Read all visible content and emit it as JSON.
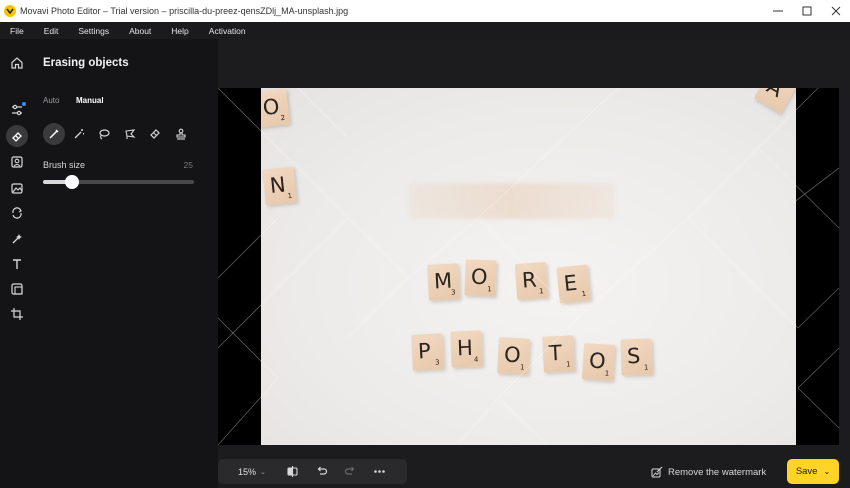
{
  "window": {
    "title": "Movavi Photo Editor – Trial version – priscilla-du-preez-qensZDlj_MA-unsplash.jpg",
    "minimize_icon": "minimize-icon",
    "maximize_icon": "maximize-icon",
    "close_icon": "close-icon"
  },
  "menu": {
    "items": [
      "File",
      "Edit",
      "Settings",
      "About",
      "Help",
      "Activation"
    ]
  },
  "rail": {
    "items": [
      "home-icon",
      "adjust-icon",
      "eraser-icon",
      "portrait-icon",
      "replace-background-icon",
      "transform-icon",
      "retouch-icon",
      "text-icon",
      "frame-icon",
      "crop-icon"
    ]
  },
  "panel": {
    "title": "Erasing objects",
    "tabs": [
      "Auto",
      "Manual"
    ],
    "active_tab": "Manual",
    "tools": [
      "brush-icon",
      "magic-wand-icon",
      "lasso-icon",
      "polygon-lasso-icon",
      "eraser-icon",
      "stamp-icon"
    ],
    "brush_size_label": "Brush size",
    "brush_size_value": "25",
    "brush_size_fraction": 0.19
  },
  "canvas": {
    "tiles": [
      {
        "letter": "O",
        "num": "2"
      },
      {
        "letter": "N",
        "num": "1"
      },
      {
        "letter": "M",
        "num": "3"
      },
      {
        "letter": "O",
        "num": "1"
      },
      {
        "letter": "R",
        "num": "1"
      },
      {
        "letter": "E",
        "num": "1"
      },
      {
        "letter": "P",
        "num": "3"
      },
      {
        "letter": "H",
        "num": "4"
      },
      {
        "letter": "O",
        "num": "1"
      },
      {
        "letter": "T",
        "num": "1"
      },
      {
        "letter": "O",
        "num": "1"
      },
      {
        "letter": "S",
        "num": "1"
      },
      {
        "letter": "A",
        "num": ""
      }
    ]
  },
  "bottom": {
    "zoom": "15%",
    "remove_watermark": "Remove the watermark",
    "save": "Save"
  },
  "colors": {
    "accent": "#ffd426",
    "background": "#1c1c1e",
    "active_dot": "#3b8cff"
  }
}
